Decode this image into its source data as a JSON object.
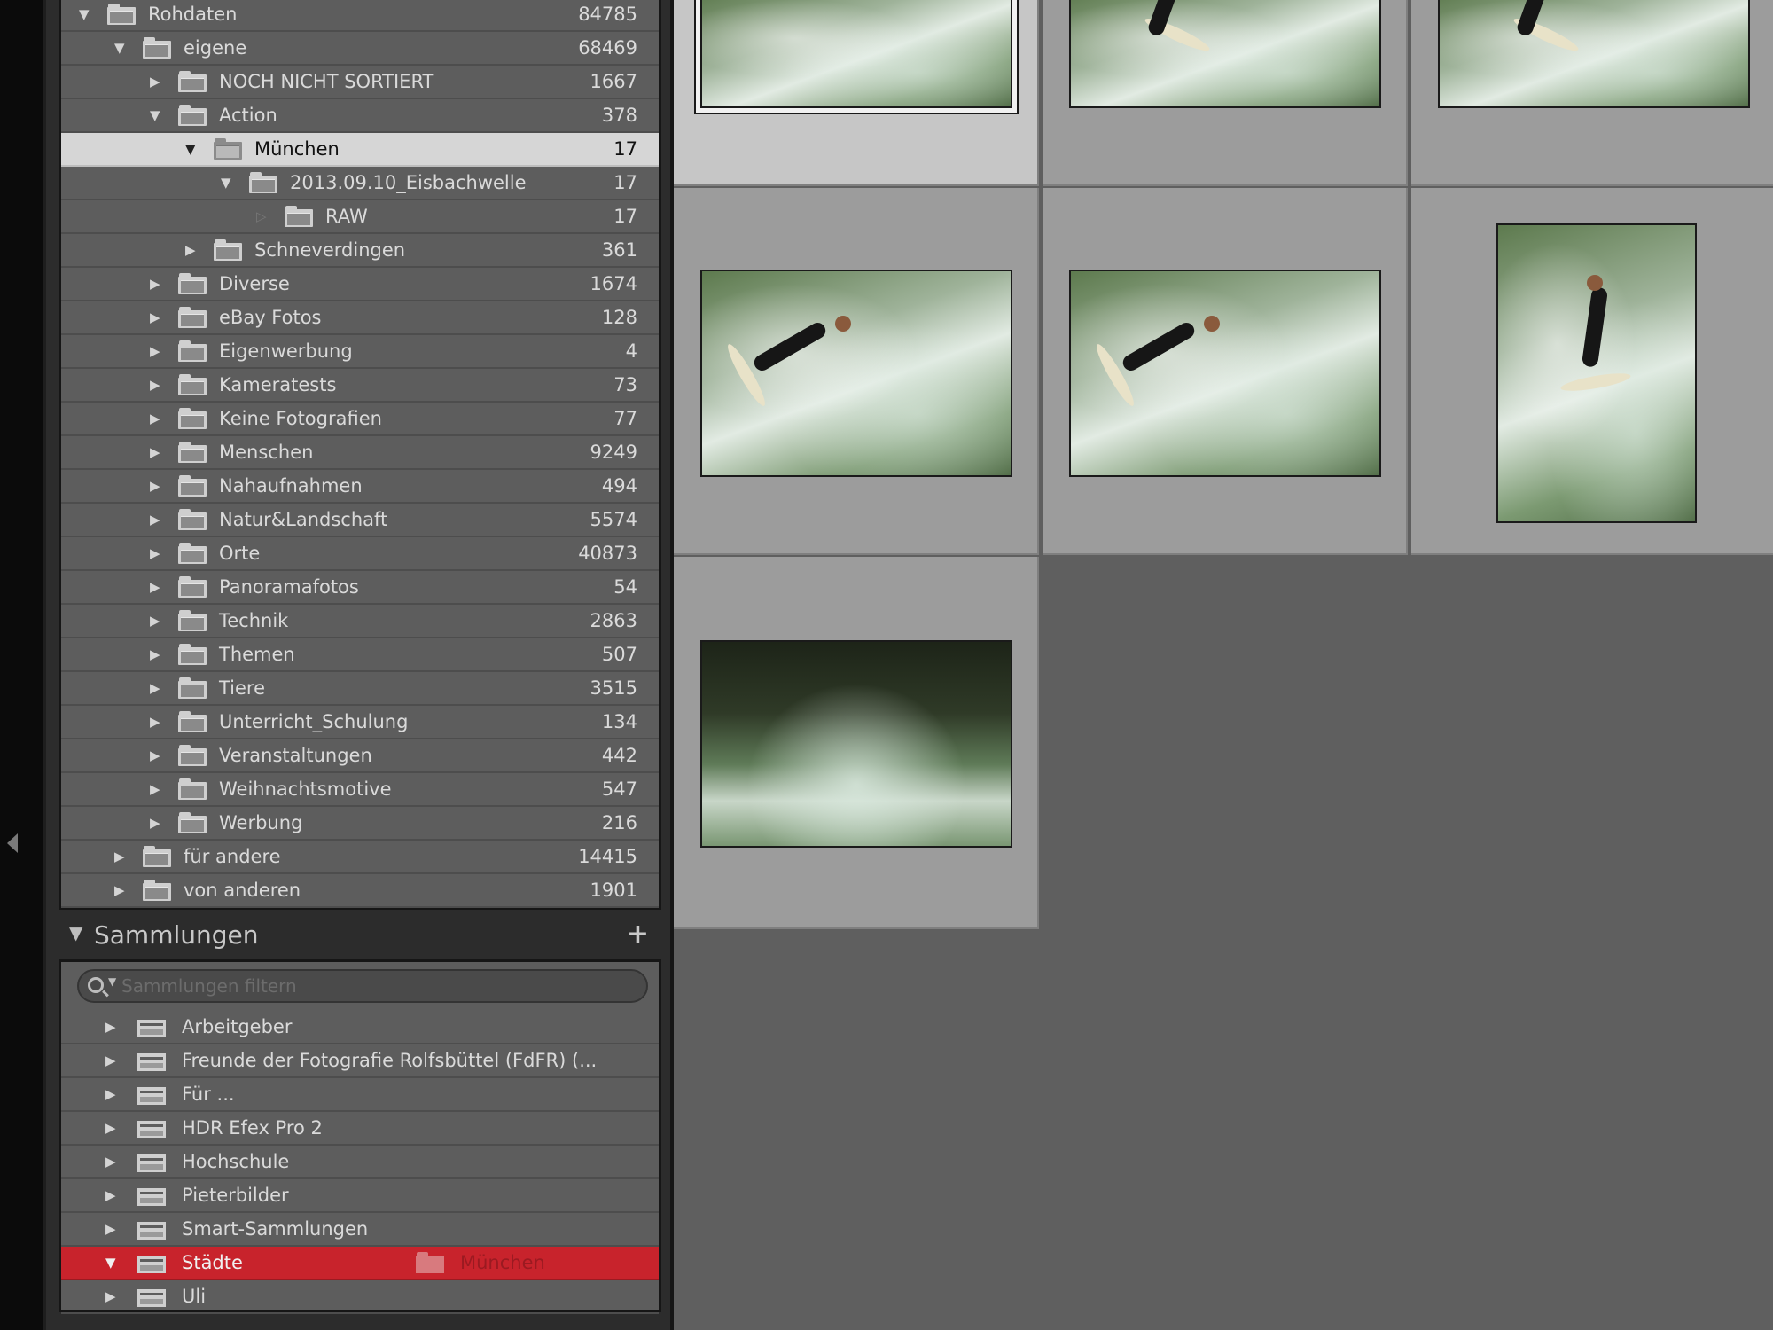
{
  "folders": [
    {
      "label": "Rohdaten",
      "count": "84785",
      "expanded": true
    },
    {
      "label": "eigene",
      "count": "68469",
      "expanded": true
    },
    {
      "label": "NOCH NICHT SORTIERT",
      "count": "1667",
      "expanded": false
    },
    {
      "label": "Action",
      "count": "378",
      "expanded": true
    },
    {
      "label": "München",
      "count": "17",
      "expanded": true,
      "selected": true
    },
    {
      "label": "2013.09.10_Eisbachwelle",
      "count": "17",
      "expanded": true
    },
    {
      "label": "RAW",
      "count": "17",
      "expanded": false
    },
    {
      "label": "Schneverdingen",
      "count": "361",
      "expanded": false
    },
    {
      "label": "Diverse",
      "count": "1674",
      "expanded": false
    },
    {
      "label": "eBay Fotos",
      "count": "128",
      "expanded": false
    },
    {
      "label": "Eigenwerbung",
      "count": "4",
      "expanded": false
    },
    {
      "label": "Kameratests",
      "count": "73",
      "expanded": false
    },
    {
      "label": "Keine Fotografien",
      "count": "77",
      "expanded": false
    },
    {
      "label": "Menschen",
      "count": "9249",
      "expanded": false
    },
    {
      "label": "Nahaufnahmen",
      "count": "494",
      "expanded": false
    },
    {
      "label": "Natur&Landschaft",
      "count": "5574",
      "expanded": false
    },
    {
      "label": "Orte",
      "count": "40873",
      "expanded": false
    },
    {
      "label": "Panoramafotos",
      "count": "54",
      "expanded": false
    },
    {
      "label": "Technik",
      "count": "2863",
      "expanded": false
    },
    {
      "label": "Themen",
      "count": "507",
      "expanded": false
    },
    {
      "label": "Tiere",
      "count": "3515",
      "expanded": false
    },
    {
      "label": "Unterricht_Schulung",
      "count": "134",
      "expanded": false
    },
    {
      "label": "Veranstaltungen",
      "count": "442",
      "expanded": false
    },
    {
      "label": "Weihnachtsmotive",
      "count": "547",
      "expanded": false
    },
    {
      "label": "Werbung",
      "count": "216",
      "expanded": false
    },
    {
      "label": "für andere",
      "count": "14415",
      "expanded": false
    },
    {
      "label": "von anderen",
      "count": "1901",
      "expanded": false
    }
  ],
  "collections": {
    "title": "Sammlungen",
    "add_symbol": "+",
    "search_placeholder": "Sammlungen filtern",
    "items": [
      {
        "label": "Arbeitgeber"
      },
      {
        "label": "Freunde der Fotografie Rolfsbüttel (FdFR) (..."
      },
      {
        "label": "Für ..."
      },
      {
        "label": "HDR Efex Pro 2"
      },
      {
        "label": "Hochschule"
      },
      {
        "label": "Pieterbilder"
      },
      {
        "label": "Smart-Sammlungen"
      },
      {
        "label": "Städte",
        "active": true,
        "target": "München"
      },
      {
        "label": "Uli"
      }
    ]
  },
  "grid": {
    "photos": [
      {
        "name": "surf-wave-1",
        "selected": true
      },
      {
        "name": "surf-wave-2"
      },
      {
        "name": "surf-wave-3"
      },
      {
        "name": "surfer-leaning-1"
      },
      {
        "name": "surfer-leaning-2"
      },
      {
        "name": "surfer-standing-portrait"
      },
      {
        "name": "eisbach-bridge-surfers"
      }
    ]
  },
  "colors": {
    "accent_red": "#c8232c",
    "selected_row": "#d6d6d6",
    "panel_bg": "#5d5d5d"
  },
  "icons": {
    "folder": "folder-icon",
    "collection_set": "collection-set-icon",
    "search": "search-icon",
    "add": "plus-icon",
    "panel_toggle": "chevron-left-icon"
  }
}
